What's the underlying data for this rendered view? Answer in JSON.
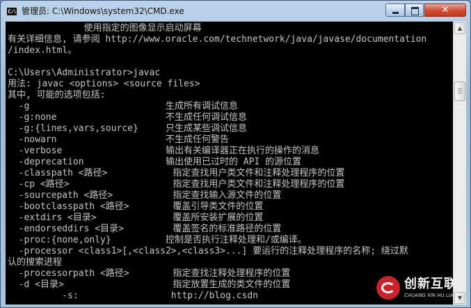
{
  "window": {
    "title": "管理员: C:\\Windows\\system32\\CMD.exe",
    "icon_text": "C:\\",
    "min_symbol": "",
    "max_symbol": "",
    "close_symbol": "✕"
  },
  "console": {
    "lines": [
      "              使用指定的图像显示启动屏幕",
      "有关详细信息, 请参阅 http://www.oracle.com/technetwork/java/javase/documentation",
      "/index.html。",
      "",
      "C:\\Users\\Administrator>javac",
      "用法: javac <options> <source files>",
      "其中, 可能的选项包括:",
      "  -g                         生成所有调试信息",
      "  -g:none                    不生成任何调试信息",
      "  -g:{lines,vars,source}     只生成某些调试信息",
      "  -nowarn                    不生成任何警告",
      "  -verbose                   输出有关编译器正在执行的操作的消息",
      "  -deprecation               输出使用已过时的 API 的源位置",
      "  -classpath <路径>            指定查找用户类文件和注释处理程序的位置",
      "  -cp <路径>                   指定查找用户类文件和注释处理程序的位置",
      "  -sourcepath <路径>           指定查找输入源文件的位置",
      "  -bootclasspath <路径>        覆盖引导类文件的位置",
      "  -extdirs <目录>              覆盖所安装扩展的位置",
      "  -endorseddirs <目录>         覆盖签名的标准路径的位置",
      "  -proc:{none,only}          控制是否执行注释处理和/或编译。",
      "  -processor <class1>[,<class2>,<class3>...] 要运行的注释处理程序的名称; 绕过默",
      "认的搜索进程",
      "  -processorpath <路径>        指定查找注释处理程序的位置",
      "  -d <目录>                    指定放置生成的类文件的位置",
      "          -s:                 http://blog.csdn"
    ]
  },
  "scrollbar": {
    "up_symbol": "▲",
    "down_symbol": "▼",
    "position_fraction": 0.2
  },
  "watermark": {
    "brand_name": "创新互联",
    "brand_sub": "CHUANG XIN HU LIAN"
  }
}
